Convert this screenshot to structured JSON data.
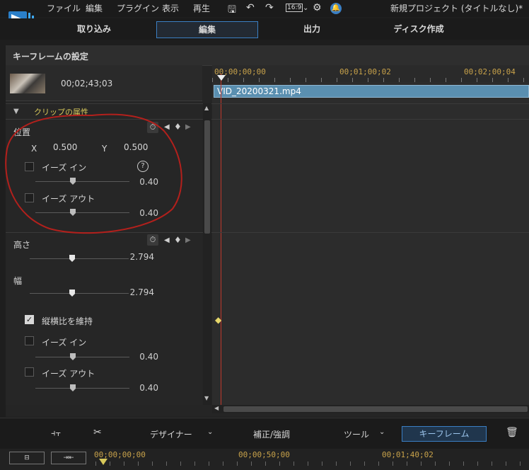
{
  "menubar": {
    "items": [
      "ファイル",
      "編集",
      "プラグイン",
      "表示",
      "再生"
    ],
    "aspect": "16:9",
    "title": "新規プロジェクト (タイトルなし)*"
  },
  "tabs": [
    "取り込み",
    "編集",
    "出力",
    "ディスク作成"
  ],
  "active_tab": "編集",
  "panel": {
    "title": "キーフレームの設定",
    "thumb_time": "00;02;43;03",
    "section": "クリップの属性"
  },
  "ruler": {
    "ticks": [
      "00;00;00;00",
      "00;01;00;02",
      "00;02;00;04"
    ]
  },
  "clip": {
    "name": "VID_20200321.mp4"
  },
  "position": {
    "label": "位置",
    "x_label": "X",
    "x_value": "0.500",
    "y_label": "Y",
    "y_value": "0.500",
    "ease_in": "イーズ イン",
    "ease_in_value": "0.40",
    "ease_out": "イーズ アウト",
    "ease_out_value": "0.40"
  },
  "height": {
    "label": "高さ",
    "value": "2.794"
  },
  "width": {
    "label": "幅",
    "value": "2.794"
  },
  "aspect_keep": {
    "label": "縦横比を維持",
    "checked": true
  },
  "ease2": {
    "in": "イーズ イン",
    "in_value": "0.40",
    "out": "イーズ アウト",
    "out_value": "0.40"
  },
  "bottom": {
    "designer": "デザイナー",
    "correction": "補正/強調",
    "tools": "ツール",
    "keyframe": "キーフレーム"
  },
  "bottom_ruler": [
    "00;00;00;00",
    "00;00;50;00",
    "00;01;40;02"
  ],
  "colors": {
    "accent": "#3b7fc4",
    "clip": "#5a8fb0",
    "annotation": "#b3201c",
    "ruler_text": "#c8a24a"
  }
}
